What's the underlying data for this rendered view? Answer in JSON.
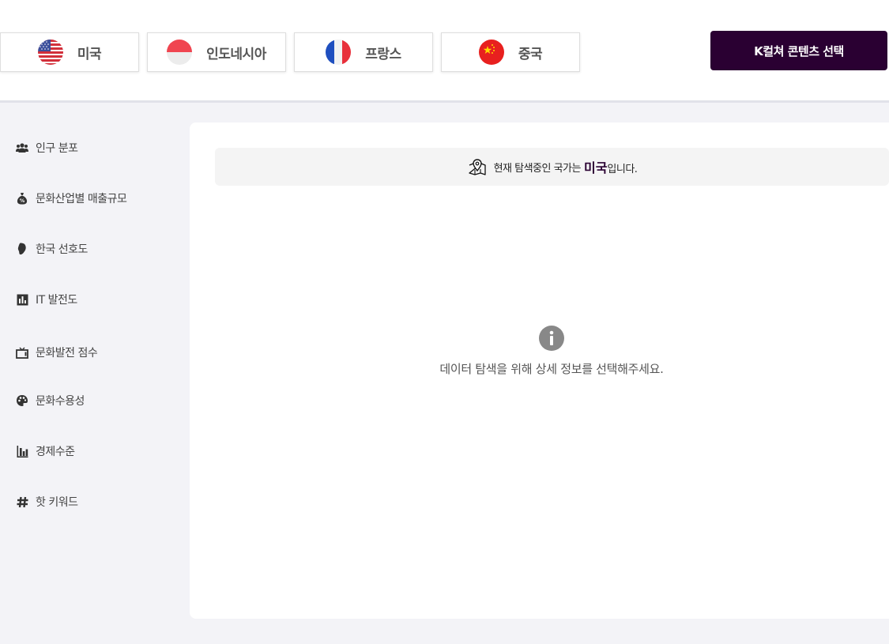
{
  "countries": [
    {
      "label": "미국",
      "flag": "us-flag-icon"
    },
    {
      "label": "인도네시아",
      "flag": "indonesia-flag-icon"
    },
    {
      "label": "프랑스",
      "flag": "france-flag-icon"
    },
    {
      "label": "중국",
      "flag": "china-flag-icon"
    }
  ],
  "header": {
    "kculture_button": "K컬쳐 콘텐츠 선택"
  },
  "sidebar": {
    "items": [
      {
        "label": "인구 분포",
        "icon": "people-icon"
      },
      {
        "label": "문화산업별 매출규모",
        "icon": "money-bag-icon"
      },
      {
        "label": "한국 선호도",
        "icon": "korea-map-icon"
      },
      {
        "label": "IT 발전도",
        "icon": "it-chart-icon"
      },
      {
        "label": "문화발전 점수",
        "icon": "tv-icon"
      },
      {
        "label": "문화수용성",
        "icon": "palette-icon"
      },
      {
        "label": "경제수준",
        "icon": "bar-chart-icon"
      },
      {
        "label": "핫 키워드",
        "icon": "hashtag-icon"
      }
    ]
  },
  "main": {
    "info_prefix": "현재 탐색중인 국가는",
    "current_country": "미국",
    "info_suffix": "입니다.",
    "empty_message": "데이터 탐색을 위해 상세 정보를 선택해주세요."
  },
  "colors": {
    "accent": "#2a0032",
    "sidebar_bg": "#f3f3f7",
    "panel_bg": "#ffffff"
  }
}
